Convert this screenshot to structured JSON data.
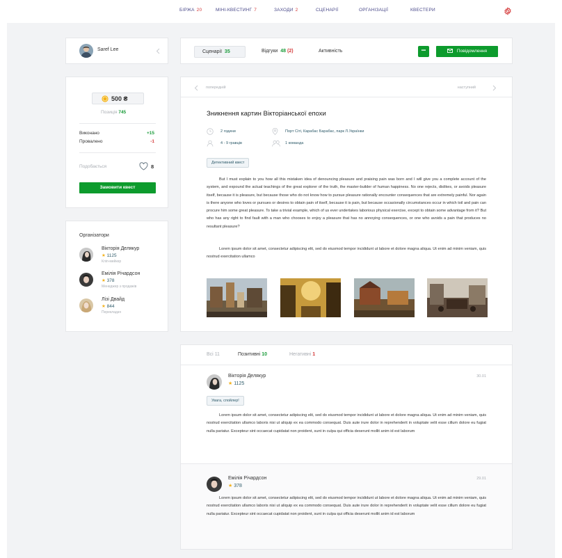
{
  "nav": {
    "items": [
      {
        "label": "БІРЖА",
        "count": "20"
      },
      {
        "label": "МІНІ-КВЕСТИНГ",
        "count": "7"
      },
      {
        "label": "ЗАХОДИ",
        "count": "2"
      },
      {
        "label": "СЦЕНАРІЇ",
        "count": ""
      },
      {
        "label": "ОРГАНІЗАЦІЇ",
        "count": ""
      },
      {
        "label": "КВЕСТЕРИ",
        "count": ""
      }
    ],
    "settings_icon": "gear-icon"
  },
  "profile": {
    "name": "Saref Lee",
    "balance": "500 ₴",
    "position_label": "Позиція",
    "position_value": "745",
    "done_label": "Виконано",
    "done_value": "+15",
    "failed_label": "Провалено",
    "failed_value": "-1",
    "likes_label": "Подобається",
    "likes_value": "8",
    "order_button": "Замовити квест"
  },
  "organizers": {
    "title": "Організатори",
    "people": [
      {
        "name": "Вікторія Делякур",
        "rating": "1125",
        "role": "Кліп-мейкер"
      },
      {
        "name": "Емілія Річардсон",
        "rating": "378",
        "role": "Менеджер з продажів"
      },
      {
        "name": "Лізі Двайд",
        "rating": "844",
        "role": "Перекладач"
      }
    ]
  },
  "tabs": {
    "scenarios_label": "Сценарії",
    "scenarios_count": "35",
    "reviews_label": "Відгуки",
    "reviews_count": "48",
    "reviews_new": "(2)",
    "activity_label": "Активність",
    "more_label": "•••",
    "message_button": "Повідомлення"
  },
  "scenario": {
    "prev": "попередній",
    "next": "наступний",
    "title": "Зникнення картин Вікторіанської епохи",
    "duration": "2 години",
    "location": "Порт Сіті, Карабас Барабас, парк Л.Українки",
    "players": "4 - 9 гравців",
    "teams": "1 команда",
    "tag": "Детективний квест",
    "paragraph1": "But I must explain to you how all this mistaken idea of denouncing pleasure and praising pain was born and I will give you a complete account of the system, and expound the actual teachings of the great explorer of the truth, the master-builder of human happiness. No one rejects, dislikes, or avoids pleasure itself, because it is pleasure, but because those who do not know how to pursue pleasure rationally encounter consequences that are extremely painful. Nor again is there anyone who loves or pursues or desires to obtain pain of itself, because it is pain, but because occasionally circumstances occur in which toil and pain can procure him some great pleasure. To take a trivial example, which of us ever undertakes laborious physical exercise, except to obtain some advantage from it? But who has any right to find fault with a man who chooses to enjoy a pleasure that has no annoying consequences, or one who avoids a pain that produces no resultant pleasure?",
    "paragraph2": "Lorem ipsum dolor sit amet, consectetur adipiscing elit, sed do eiusmod tempor incididunt ut labore et dolore magna aliqua. Ut enim ad minim veniam, quis nostrud exercitation ullamco"
  },
  "reviews": {
    "filter_all_label": "Всі",
    "filter_all_count": "11",
    "filter_pos_label": "Позитивні",
    "filter_pos_count": "10",
    "filter_neg_label": "Негативні",
    "filter_neg_count": "1",
    "items": [
      {
        "name": "Вікторія Делякур",
        "rating": "1125",
        "date": "30.01",
        "spoiler": "Увага, спойлер!",
        "text": "Lorem ipsum dolor sit amet, consectetur adipiscing elit, sed do eiusmod tempor incididunt ut labore et dolore magna aliqua. Ut enim ad minim veniam, quis nostrud exercitation ullamco laboris nisi ut aliquip ex ea commodo consequat. Duis aute irure dolor in reprehenderit in voluptate velit esse cillum dolore eu fugiat nulla pariatur. Excepteur sint occaecat cupidatat non proident, sunt in culpa qui officia deserunt mollit anim id est laborum"
      },
      {
        "name": "Емілія Річардсон",
        "rating": "378",
        "date": "29.01",
        "text": "Lorem ipsum dolor sit amet, consectetur adipiscing elit, sed do eiusmod tempor incididunt ut labore et dolore magna aliqua. Ut enim ad minim veniam, quis nostrud exercitation ullamco laboris nisi ut aliquip ex ea commodo consequat. Duis aute irure dolor in reprehenderit in voluptate velit esse cillum dolore eu fugiat nulla pariatur. Excepteur sint occaecat cupidatat non proident, sunt in culpa qui officia deserunt mollit anim id est laborum"
      }
    ]
  },
  "colors": {
    "accent_green": "#0d9b2d",
    "count_red": "#d43a3a",
    "nav_text": "#4a4a8a",
    "coin_gold": "#f3b21b"
  }
}
